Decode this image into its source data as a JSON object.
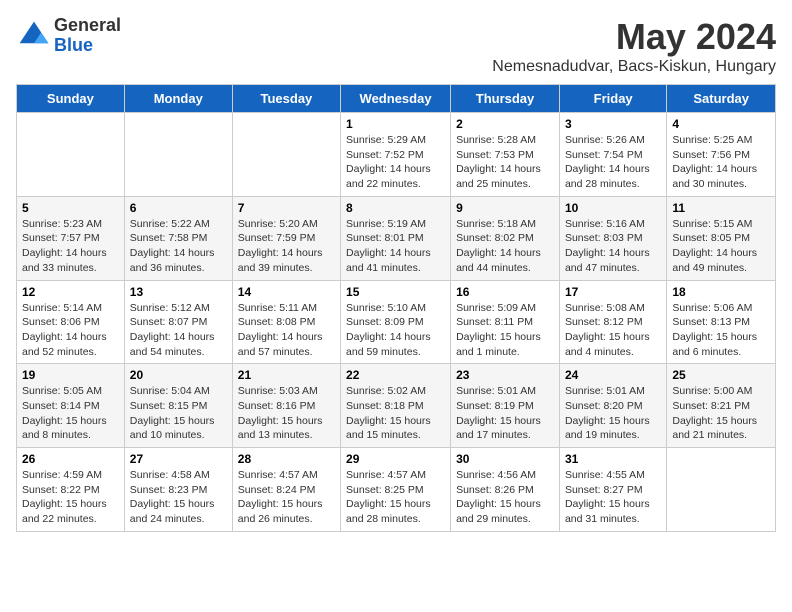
{
  "logo": {
    "general": "General",
    "blue": "Blue"
  },
  "title": {
    "month": "May 2024",
    "location": "Nemesnadudvar, Bacs-Kiskun, Hungary"
  },
  "weekdays": [
    "Sunday",
    "Monday",
    "Tuesday",
    "Wednesday",
    "Thursday",
    "Friday",
    "Saturday"
  ],
  "weeks": [
    [
      {
        "day": "",
        "info": ""
      },
      {
        "day": "",
        "info": ""
      },
      {
        "day": "",
        "info": ""
      },
      {
        "day": "1",
        "info": "Sunrise: 5:29 AM\nSunset: 7:52 PM\nDaylight: 14 hours\nand 22 minutes."
      },
      {
        "day": "2",
        "info": "Sunrise: 5:28 AM\nSunset: 7:53 PM\nDaylight: 14 hours\nand 25 minutes."
      },
      {
        "day": "3",
        "info": "Sunrise: 5:26 AM\nSunset: 7:54 PM\nDaylight: 14 hours\nand 28 minutes."
      },
      {
        "day": "4",
        "info": "Sunrise: 5:25 AM\nSunset: 7:56 PM\nDaylight: 14 hours\nand 30 minutes."
      }
    ],
    [
      {
        "day": "5",
        "info": "Sunrise: 5:23 AM\nSunset: 7:57 PM\nDaylight: 14 hours\nand 33 minutes."
      },
      {
        "day": "6",
        "info": "Sunrise: 5:22 AM\nSunset: 7:58 PM\nDaylight: 14 hours\nand 36 minutes."
      },
      {
        "day": "7",
        "info": "Sunrise: 5:20 AM\nSunset: 7:59 PM\nDaylight: 14 hours\nand 39 minutes."
      },
      {
        "day": "8",
        "info": "Sunrise: 5:19 AM\nSunset: 8:01 PM\nDaylight: 14 hours\nand 41 minutes."
      },
      {
        "day": "9",
        "info": "Sunrise: 5:18 AM\nSunset: 8:02 PM\nDaylight: 14 hours\nand 44 minutes."
      },
      {
        "day": "10",
        "info": "Sunrise: 5:16 AM\nSunset: 8:03 PM\nDaylight: 14 hours\nand 47 minutes."
      },
      {
        "day": "11",
        "info": "Sunrise: 5:15 AM\nSunset: 8:05 PM\nDaylight: 14 hours\nand 49 minutes."
      }
    ],
    [
      {
        "day": "12",
        "info": "Sunrise: 5:14 AM\nSunset: 8:06 PM\nDaylight: 14 hours\nand 52 minutes."
      },
      {
        "day": "13",
        "info": "Sunrise: 5:12 AM\nSunset: 8:07 PM\nDaylight: 14 hours\nand 54 minutes."
      },
      {
        "day": "14",
        "info": "Sunrise: 5:11 AM\nSunset: 8:08 PM\nDaylight: 14 hours\nand 57 minutes."
      },
      {
        "day": "15",
        "info": "Sunrise: 5:10 AM\nSunset: 8:09 PM\nDaylight: 14 hours\nand 59 minutes."
      },
      {
        "day": "16",
        "info": "Sunrise: 5:09 AM\nSunset: 8:11 PM\nDaylight: 15 hours\nand 1 minute."
      },
      {
        "day": "17",
        "info": "Sunrise: 5:08 AM\nSunset: 8:12 PM\nDaylight: 15 hours\nand 4 minutes."
      },
      {
        "day": "18",
        "info": "Sunrise: 5:06 AM\nSunset: 8:13 PM\nDaylight: 15 hours\nand 6 minutes."
      }
    ],
    [
      {
        "day": "19",
        "info": "Sunrise: 5:05 AM\nSunset: 8:14 PM\nDaylight: 15 hours\nand 8 minutes."
      },
      {
        "day": "20",
        "info": "Sunrise: 5:04 AM\nSunset: 8:15 PM\nDaylight: 15 hours\nand 10 minutes."
      },
      {
        "day": "21",
        "info": "Sunrise: 5:03 AM\nSunset: 8:16 PM\nDaylight: 15 hours\nand 13 minutes."
      },
      {
        "day": "22",
        "info": "Sunrise: 5:02 AM\nSunset: 8:18 PM\nDaylight: 15 hours\nand 15 minutes."
      },
      {
        "day": "23",
        "info": "Sunrise: 5:01 AM\nSunset: 8:19 PM\nDaylight: 15 hours\nand 17 minutes."
      },
      {
        "day": "24",
        "info": "Sunrise: 5:01 AM\nSunset: 8:20 PM\nDaylight: 15 hours\nand 19 minutes."
      },
      {
        "day": "25",
        "info": "Sunrise: 5:00 AM\nSunset: 8:21 PM\nDaylight: 15 hours\nand 21 minutes."
      }
    ],
    [
      {
        "day": "26",
        "info": "Sunrise: 4:59 AM\nSunset: 8:22 PM\nDaylight: 15 hours\nand 22 minutes."
      },
      {
        "day": "27",
        "info": "Sunrise: 4:58 AM\nSunset: 8:23 PM\nDaylight: 15 hours\nand 24 minutes."
      },
      {
        "day": "28",
        "info": "Sunrise: 4:57 AM\nSunset: 8:24 PM\nDaylight: 15 hours\nand 26 minutes."
      },
      {
        "day": "29",
        "info": "Sunrise: 4:57 AM\nSunset: 8:25 PM\nDaylight: 15 hours\nand 28 minutes."
      },
      {
        "day": "30",
        "info": "Sunrise: 4:56 AM\nSunset: 8:26 PM\nDaylight: 15 hours\nand 29 minutes."
      },
      {
        "day": "31",
        "info": "Sunrise: 4:55 AM\nSunset: 8:27 PM\nDaylight: 15 hours\nand 31 minutes."
      },
      {
        "day": "",
        "info": ""
      }
    ]
  ]
}
